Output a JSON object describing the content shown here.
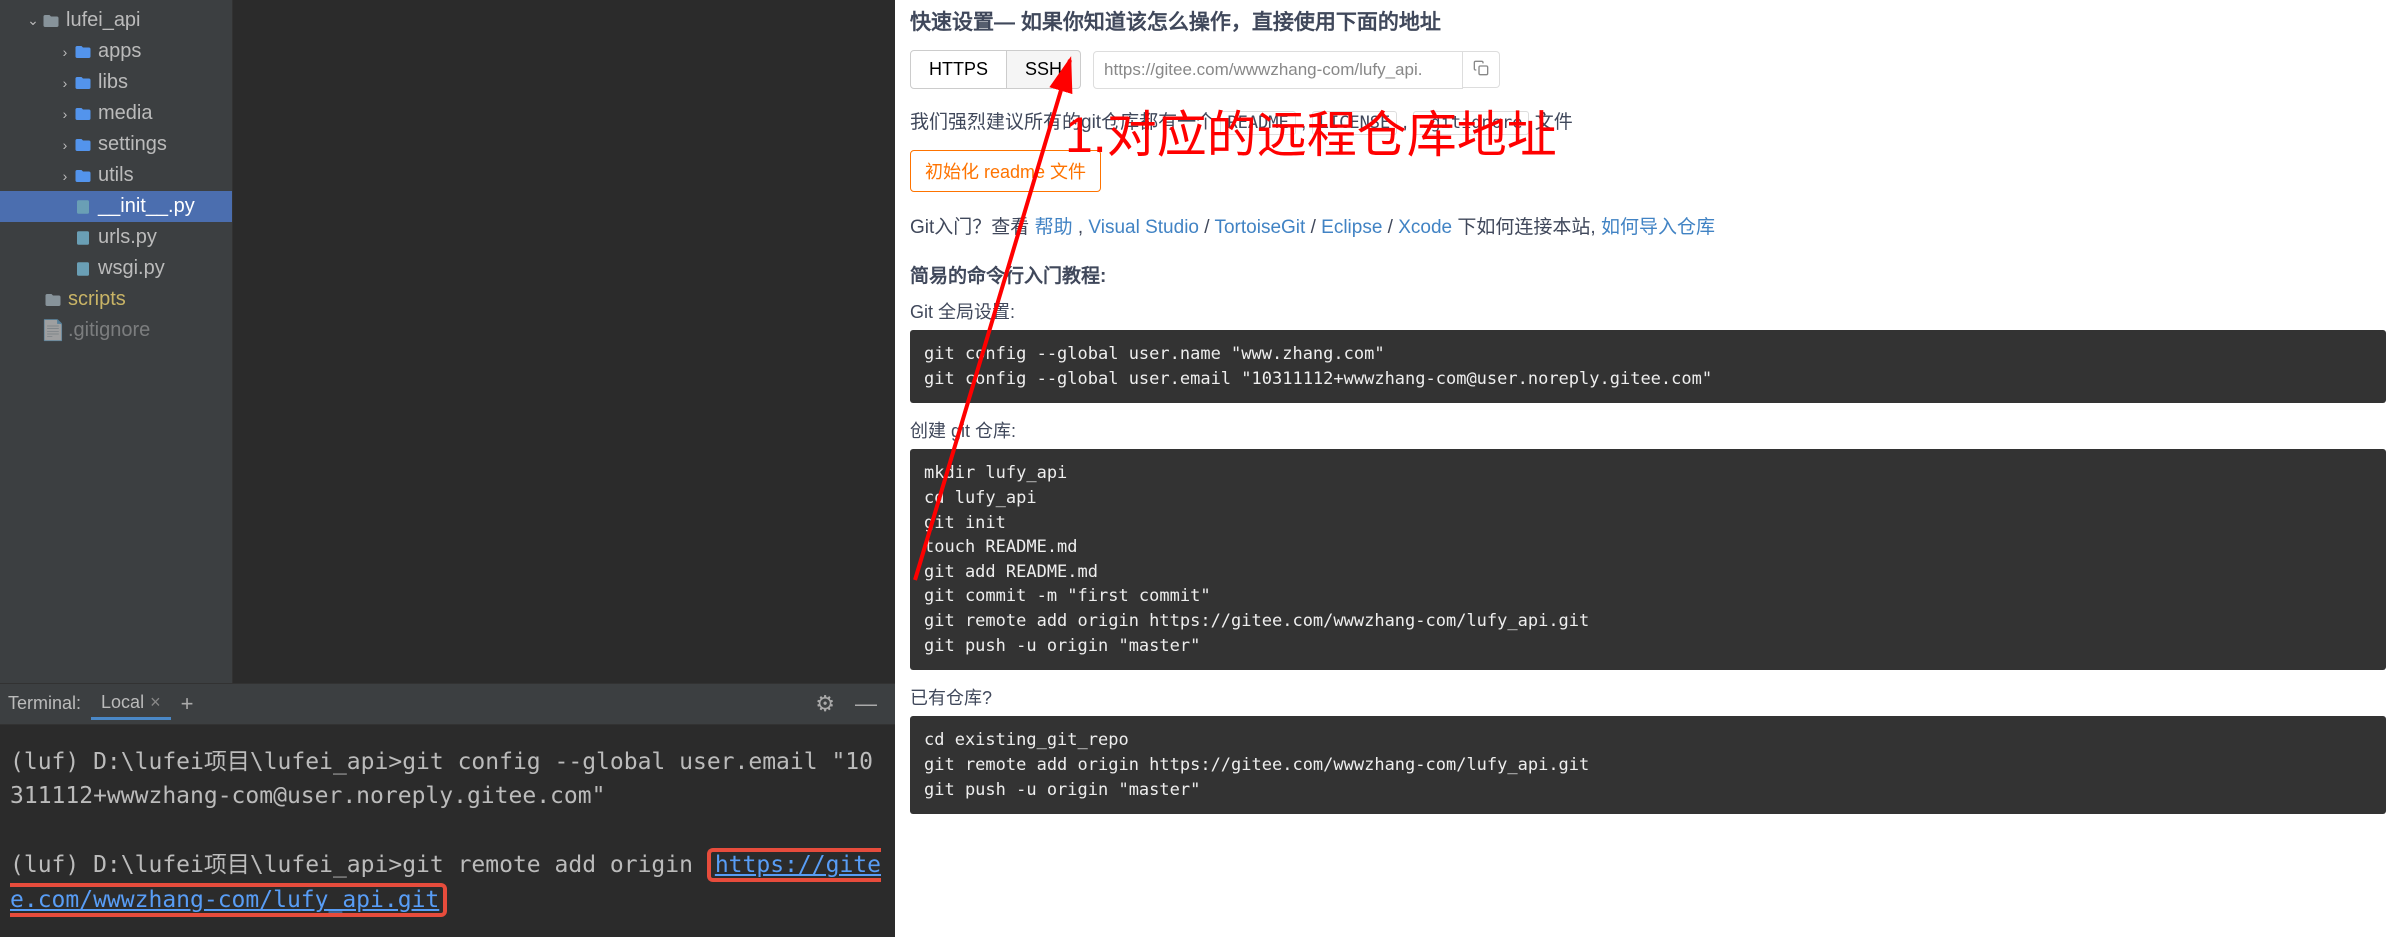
{
  "ide": {
    "tree": {
      "root": "lufei_api",
      "folders": [
        "apps",
        "libs",
        "media",
        "settings",
        "utils"
      ],
      "files": [
        "__init__.py",
        "urls.py",
        "wsgi.py"
      ],
      "scripts": "scripts",
      "gitignore": ".gitignore"
    },
    "terminal_bar": {
      "label": "Terminal:",
      "tab": "Local",
      "plus": "+",
      "gear": "⚙",
      "min": "—"
    },
    "terminal": {
      "line1_prefix": "(luf) D:\\lufei项目\\lufei_api>",
      "line1_cmd": "git config --global user.email \"10311112+wwwzhang-com@user.noreply.gitee.com\"",
      "line2_prefix": "(luf) D:\\lufei项目\\lufei_api>",
      "line2_cmd": "git remote add origin ",
      "line2_url": "https://gitee.com/wwwzhang-com/lufy_api.git"
    }
  },
  "gitee": {
    "quick_title": "快速设置— 如果你知道该怎么操作，直接使用下面的地址",
    "proto_https": "HTTPS",
    "proto_ssh": "SSH",
    "url": "https://gitee.com/wwwzhang-com/lufy_api.",
    "suggest_prefix": "我们强烈建议所有的git仓库都有一个 ",
    "chip_readme": "README",
    "chip_license": "LICENSE",
    "chip_gitignore": ".gitignore",
    "suggest_suffix": " 文件",
    "init_btn": "初始化 readme 文件",
    "help_prefix": "Git入门？查看 ",
    "help_help": "帮助",
    "help_vs": "Visual Studio",
    "help_tg": "TortoiseGit",
    "help_ec": "Eclipse",
    "help_xc": "Xcode",
    "help_mid": " 下如何连接本站, ",
    "help_import": "如何导入仓库",
    "tutorial_h": "简易的命令行入门教程:",
    "global_h": "Git 全局设置:",
    "global_code": "git config --global user.name \"www.zhang.com\"\ngit config --global user.email \"10311112+wwwzhang-com@user.noreply.gitee.com\"",
    "create_h": "创建 git 仓库:",
    "create_code": "mkdir lufy_api\ncd lufy_api\ngit init\ntouch README.md\ngit add README.md\ngit commit -m \"first commit\"\ngit remote add origin https://gitee.com/wwwzhang-com/lufy_api.git\ngit push -u origin \"master\"",
    "exist_h": "已有仓库?",
    "exist_code": "cd existing_git_repo\ngit remote add origin https://gitee.com/wwwzhang-com/lufy_api.git\ngit push -u origin \"master\""
  },
  "annotation": "1.对应的远程仓库地址"
}
